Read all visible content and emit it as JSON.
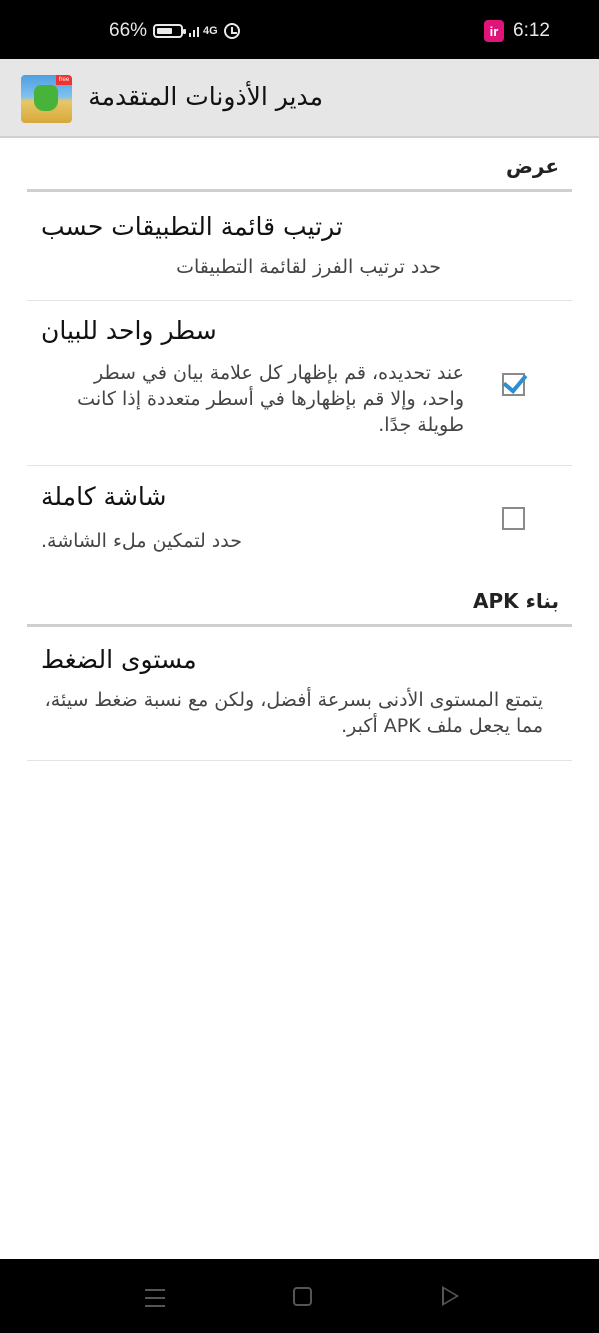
{
  "status_bar": {
    "battery": "66%",
    "battery_level": 0.66,
    "network": "4G",
    "notification_icon": "ir",
    "time": "6:12"
  },
  "app_bar": {
    "title": "مدير الأذونات المتقدمة",
    "icon": "app-hand-icon",
    "badge": "free"
  },
  "sections": [
    {
      "header": "عرض",
      "prefs": [
        {
          "title": "ترتيب قائمة التطبيقات حسب",
          "summary": "حدد ترتيب الفرز لقائمة التطبيقات"
        },
        {
          "title": "سطر واحد للبيان",
          "summary": "عند تحديده، قم بإظهار كل علامة بيان في سطر واحد، وإلا قم بإظهارها في أسطر متعددة إذا كانت طويلة جدًا.",
          "checked": true
        },
        {
          "title": "شاشة كاملة",
          "summary": "حدد لتمكين ملء الشاشة.",
          "checked": false
        }
      ]
    },
    {
      "header": "بناء APK",
      "prefs": [
        {
          "title": "مستوى الضغط",
          "summary": "يتمتع المستوى الأدنى بسرعة أفضل، ولكن مع نسبة ضغط سيئة، مما يجعل ملف APK أكبر."
        }
      ]
    }
  ],
  "nav_bar": {
    "icons": [
      "menu-icon",
      "home-icon",
      "back-icon"
    ]
  },
  "colors": {
    "accent": "#2e8fd0",
    "app_bar_bg": "#e6e6e6",
    "divider": "#cfcfcf"
  }
}
